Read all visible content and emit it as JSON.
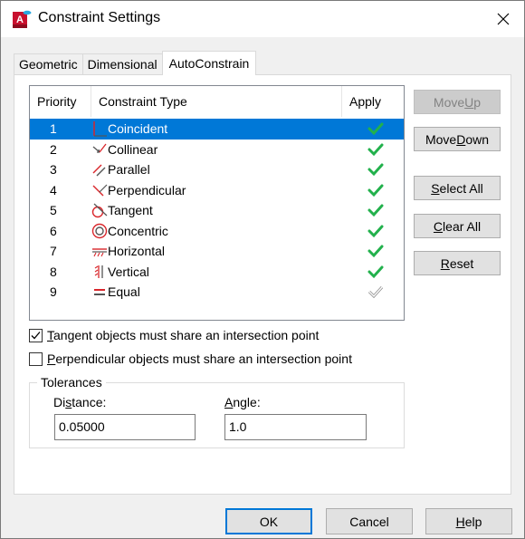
{
  "window": {
    "title": "Constraint Settings",
    "app_icon": "autocad-app-icon",
    "close_icon": "close-icon"
  },
  "tabs": [
    {
      "label": "Geometric",
      "active": false
    },
    {
      "label": "Dimensional",
      "active": false
    },
    {
      "label": "AutoConstrain",
      "active": true
    }
  ],
  "list": {
    "columns": [
      "Priority",
      "Constraint Type",
      "Apply"
    ],
    "rows": [
      {
        "priority": "1",
        "type": "Coincident",
        "icon": "coincident-icon",
        "apply": true,
        "selected": true
      },
      {
        "priority": "2",
        "type": "Collinear",
        "icon": "collinear-icon",
        "apply": true,
        "selected": false
      },
      {
        "priority": "3",
        "type": "Parallel",
        "icon": "parallel-icon",
        "apply": true,
        "selected": false
      },
      {
        "priority": "4",
        "type": "Perpendicular",
        "icon": "perpendicular-icon",
        "apply": true,
        "selected": false
      },
      {
        "priority": "5",
        "type": "Tangent",
        "icon": "tangent-icon",
        "apply": true,
        "selected": false
      },
      {
        "priority": "6",
        "type": "Concentric",
        "icon": "concentric-icon",
        "apply": true,
        "selected": false
      },
      {
        "priority": "7",
        "type": "Horizontal",
        "icon": "horizontal-icon",
        "apply": true,
        "selected": false
      },
      {
        "priority": "8",
        "type": "Vertical",
        "icon": "vertical-icon",
        "apply": true,
        "selected": false
      },
      {
        "priority": "9",
        "type": "Equal",
        "icon": "equal-icon",
        "apply": false,
        "selected": false
      }
    ],
    "colors": {
      "selected": "#0078d7",
      "check_on": "#22b14c",
      "check_off": "#8a8a8a",
      "icon_red": "#d9262b"
    }
  },
  "side_buttons": {
    "move_up": {
      "pre": "Move ",
      "mn": "U",
      "post": "p",
      "enabled": false
    },
    "move_down": {
      "pre": "Move ",
      "mn": "D",
      "post": "own",
      "enabled": true
    },
    "select_all": {
      "pre": "",
      "mn": "S",
      "post": "elect All",
      "enabled": true
    },
    "clear_all": {
      "pre": "",
      "mn": "C",
      "post": "lear All",
      "enabled": true
    },
    "reset": {
      "pre": "",
      "mn": "R",
      "post": "eset",
      "enabled": true
    }
  },
  "options": {
    "tangent": {
      "mn": "T",
      "rest": "angent objects must share an intersection point",
      "checked": true
    },
    "perpendicular": {
      "mn": "P",
      "rest": "erpendicular objects must share an intersection point",
      "checked": false
    }
  },
  "tolerances": {
    "label": "Tolerances",
    "distance": {
      "pre": "Di",
      "mn": "s",
      "post": "tance:",
      "value": "0.05000"
    },
    "angle": {
      "pre": "",
      "mn": "A",
      "post": "ngle:",
      "value": "1.0"
    }
  },
  "footer": {
    "ok": {
      "pre": "OK",
      "mn": "",
      "post": ""
    },
    "cancel": {
      "pre": "Cancel",
      "mn": "",
      "post": ""
    },
    "help": {
      "pre": "",
      "mn": "H",
      "post": "elp"
    }
  }
}
